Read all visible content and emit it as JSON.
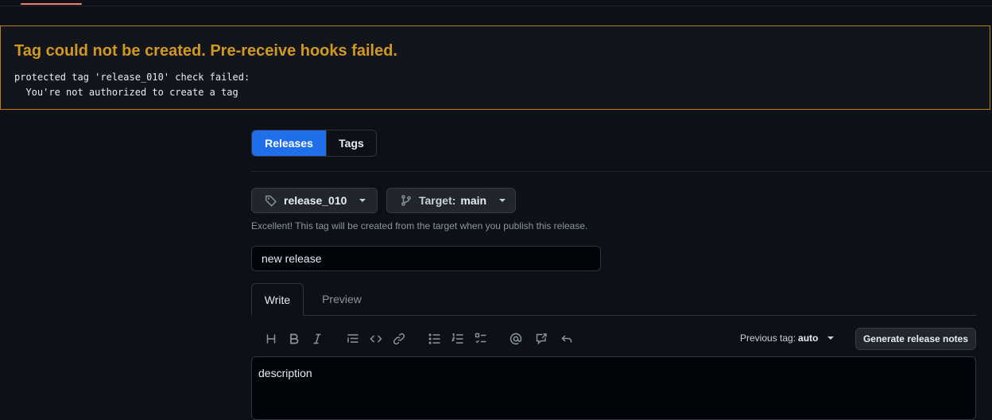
{
  "flash": {
    "title": "Tag could not be created. Pre-receive hooks failed.",
    "message": "protected tag 'release_010' check failed:\n  You're not authorized to create a tag"
  },
  "nav": {
    "releases_label": "Releases",
    "tags_label": "Tags"
  },
  "tag_picker": {
    "value": "release_010"
  },
  "target_picker": {
    "label": "Target:",
    "value": "main"
  },
  "hint": "Excellent! This tag will be created from the target when you publish this release.",
  "title_field": {
    "value": "new release"
  },
  "editor_tabs": {
    "write": "Write",
    "preview": "Preview"
  },
  "toolbar": {
    "icons": [
      "heading-icon",
      "bold-icon",
      "italic-icon",
      "quote-icon",
      "code-icon",
      "link-icon",
      "bulleted-list-icon",
      "numbered-list-icon",
      "task-list-icon",
      "mention-icon",
      "cross-reference-icon",
      "reply-icon"
    ],
    "previous_tag_label": "Previous tag:",
    "previous_tag_value": "auto",
    "generate_notes_label": "Generate release notes"
  },
  "description": {
    "value": "description"
  },
  "colors": {
    "accent": "#1f6feb",
    "warning": "#d29922",
    "background": "#0d1117"
  }
}
